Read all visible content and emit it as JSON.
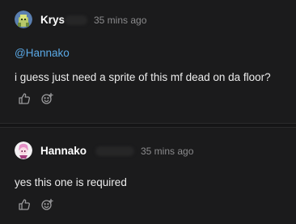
{
  "comments": [
    {
      "author": "Krys",
      "timestamp": "35 mins ago",
      "mention": "@Hannako",
      "text": "i guess just need a sprite of this mf dead on da floor?",
      "avatar_icon": "user-avatar-green-character"
    },
    {
      "author": "Hannako",
      "timestamp": "35 mins ago",
      "text": "yes this one is required",
      "avatar_icon": "user-avatar-pink-character"
    }
  ],
  "icons": {
    "like": "thumbs-up-icon",
    "react": "add-reaction-icon"
  },
  "colors": {
    "background": "#1b1b1c",
    "mention": "#5aa9e6",
    "timestamp": "#8b8b8d",
    "text": "#ececec"
  }
}
